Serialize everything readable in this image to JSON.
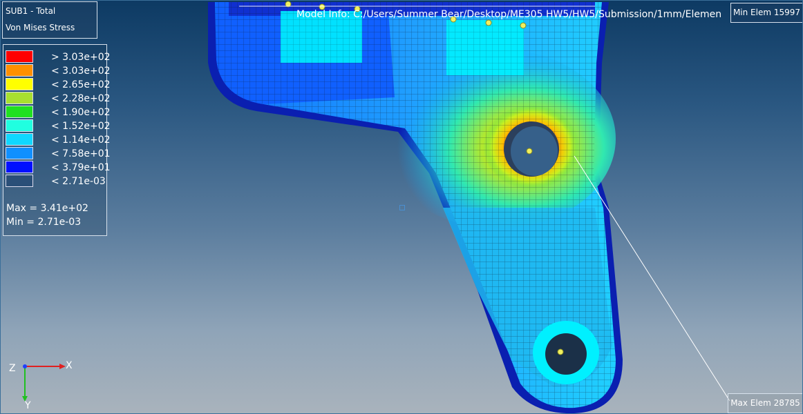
{
  "header": {
    "subcase": "SUB1 - Total",
    "result_type": "Von Mises Stress",
    "model_info": "Model Info: C:/Users/Summer Bear/Desktop/ME305 HW5/HW5/Submission/1mm/Elemen"
  },
  "legend": {
    "entries": [
      {
        "label": "> 3.03e+02",
        "color": "#ff0000"
      },
      {
        "label": "< 3.03e+02",
        "color": "#ff9000"
      },
      {
        "label": "< 2.65e+02",
        "color": "#ffff00"
      },
      {
        "label": "< 2.28e+02",
        "color": "#a8e030"
      },
      {
        "label": "< 1.90e+02",
        "color": "#20e020"
      },
      {
        "label": "< 1.52e+02",
        "color": "#20ffe0"
      },
      {
        "label": "< 1.14e+02",
        "color": "#10d8ff"
      },
      {
        "label": "< 7.58e+01",
        "color": "#1090ff"
      },
      {
        "label": "< 3.79e+01",
        "color": "#0010ff"
      },
      {
        "label": "< 2.71e-03",
        "color": "#2a4f78"
      }
    ],
    "max": "Max = 3.41e+02",
    "min": "Min = 2.71e-03"
  },
  "annotations": {
    "min_elem": "Min Elem 15997",
    "max_elem": "Max Elem 28785"
  },
  "triad": {
    "x_label": "X",
    "y_label": "Y",
    "z_label": "Z"
  }
}
